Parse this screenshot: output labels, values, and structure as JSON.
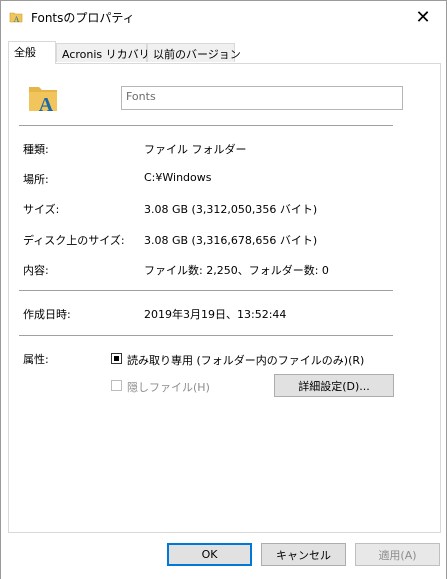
{
  "window": {
    "title": "Fontsのプロパティ"
  },
  "tabs": [
    {
      "label": "全般"
    },
    {
      "label": "Acronis リカバリ"
    },
    {
      "label": "以前のバージョン"
    }
  ],
  "general": {
    "name_field_value": "Fonts",
    "rows": [
      {
        "label": "種類:",
        "value": "ファイル フォルダー"
      },
      {
        "label": "場所:",
        "value": "C:¥Windows"
      },
      {
        "label": "サイズ:",
        "value": "3.08 GB (3,312,050,356 バイト)"
      },
      {
        "label": "ディスク上のサイズ:",
        "value": "3.08 GB (3,316,678,656 バイト)"
      },
      {
        "label": "内容:",
        "value": "ファイル数: 2,250、フォルダー数: 0"
      }
    ],
    "created": {
      "label": "作成日時:",
      "value": "2019年3月19日、13:52:44"
    },
    "attributes": {
      "label": "属性:",
      "readonly_label": "読み取り専用 (フォルダー内のファイルのみ)(R)",
      "hidden_label": "隠しファイル(H)",
      "advanced_button": "詳細設定(D)..."
    }
  },
  "buttons": {
    "ok": "OK",
    "cancel": "キャンセル",
    "apply": "適用(A)"
  },
  "icons": {
    "title": "folder-small-icon",
    "main": "fonts-folder-icon",
    "close": "close-icon"
  },
  "colors": {
    "accent": "#0078d7",
    "folder": "#f2c55c",
    "font_glyph": "#1b6aa5"
  }
}
